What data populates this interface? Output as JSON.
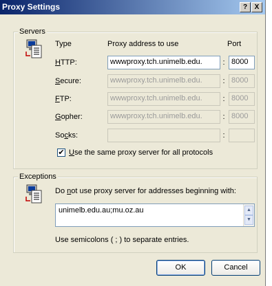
{
  "window": {
    "title": "Proxy Settings",
    "help_glyph": "?",
    "close_glyph": "X"
  },
  "servers": {
    "legend": "Servers",
    "col_type": "Type",
    "col_address": "Proxy address to use",
    "col_port": "Port",
    "rows": [
      {
        "accel": "H",
        "rest": "TTP:",
        "address": "wwwproxy.tch.unimelb.edu.",
        "port": "8000",
        "enabled": true
      },
      {
        "accel": "S",
        "rest": "ecure:",
        "address": "wwwproxy.tch.unimelb.edu.",
        "port": "8000",
        "enabled": false
      },
      {
        "accel": "F",
        "rest": "TP:",
        "address": "wwwproxy.tch.unimelb.edu.",
        "port": "8000",
        "enabled": false
      },
      {
        "accel": "G",
        "rest": "opher:",
        "address": "wwwproxy.tch.unimelb.edu.",
        "port": "8000",
        "enabled": false
      },
      {
        "pre": "So",
        "accel": "c",
        "rest": "ks:",
        "address": "",
        "port": "",
        "enabled": false
      }
    ],
    "colon": ":",
    "same_proxy_accel": "U",
    "same_proxy_rest": "se the same proxy server for all protocols",
    "same_proxy_checked": true,
    "check_glyph": "✔"
  },
  "exceptions": {
    "legend": "Exceptions",
    "desc_pre": "Do ",
    "desc_accel": "n",
    "desc_rest": "ot use proxy server for addresses beginning with:",
    "value": "unimelb.edu.au;mu.oz.au",
    "hint": "Use semicolons ( ; ) to separate entries.",
    "scroll_up": "▲",
    "scroll_down": "▼"
  },
  "buttons": {
    "ok": "OK",
    "cancel": "Cancel"
  }
}
